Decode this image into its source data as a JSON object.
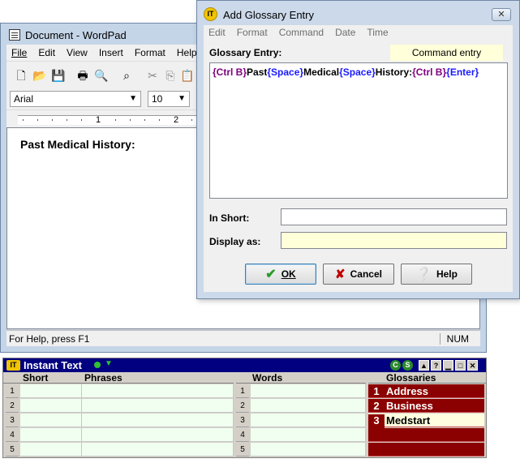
{
  "wordpad": {
    "title": "Document - WordPad",
    "menu": [
      "File",
      "Edit",
      "View",
      "Insert",
      "Format",
      "Help"
    ],
    "font_name": "Arial",
    "font_size": "10",
    "ruler_numbers": [
      "1",
      "2"
    ],
    "document_text": "Past Medical History:",
    "status_help": "For Help, press F1",
    "status_num": "NUM"
  },
  "dialog": {
    "title": "Add Glossary Entry",
    "close_label": "✕",
    "menu": [
      "Edit",
      "Format",
      "Command",
      "Date",
      "Time"
    ],
    "glossary_entry_label": "Glossary Entry:",
    "command_entry_label": "Command entry",
    "entry_tokens": [
      {
        "text": "{Ctrl B}",
        "kind": "ctrl"
      },
      {
        "text": "Past",
        "kind": "text"
      },
      {
        "text": "{Space}",
        "kind": "space"
      },
      {
        "text": "Medical",
        "kind": "text"
      },
      {
        "text": "{Space}",
        "kind": "space"
      },
      {
        "text": "History:",
        "kind": "text"
      },
      {
        "text": "{Ctrl B}",
        "kind": "ctrl"
      },
      {
        "text": "{Enter}",
        "kind": "space"
      }
    ],
    "in_short_label": "In Short:",
    "in_short_value": "",
    "display_as_label": "Display as:",
    "display_as_value": "",
    "ok_label": "OK",
    "cancel_label": "Cancel",
    "help_label": "Help"
  },
  "instant_text": {
    "title": "Instant Text",
    "col_short": "Short",
    "col_phrases": "Phrases",
    "col_words": "Words",
    "col_glossaries": "Glossaries",
    "row_numbers": [
      "1",
      "2",
      "3",
      "4",
      "5"
    ],
    "glossaries": [
      {
        "num": "1",
        "name": "Address"
      },
      {
        "num": "2",
        "name": "Business"
      },
      {
        "num": "3",
        "name": "Medstart"
      }
    ],
    "ctrl_c": "C",
    "ctrl_s": "S",
    "ctrl_help": "?"
  },
  "colors": {
    "ctrl_token": "#800080",
    "space_token": "#1a1aff",
    "glossary_bg": "#8b0000",
    "it_header": "#000080"
  }
}
